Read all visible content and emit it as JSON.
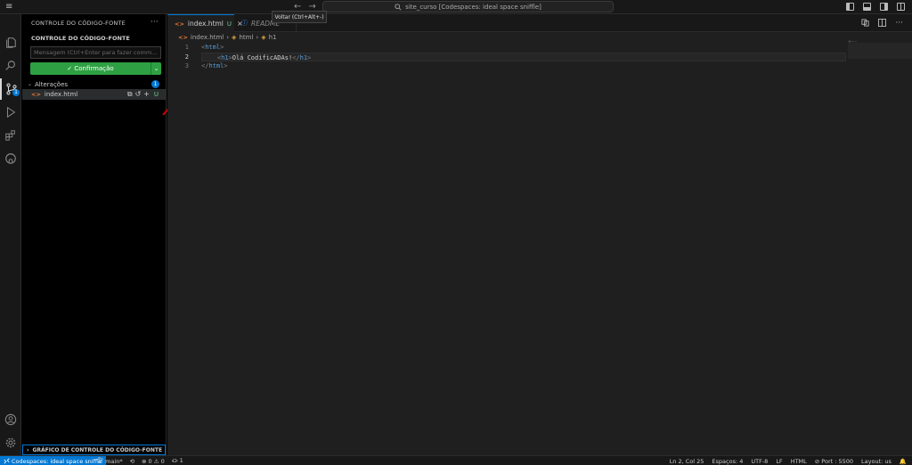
{
  "titlebar": {
    "command_center": "site_curso [Codespaces: ideal space sniffle]",
    "back_arrow": "←",
    "forward_arrow": "→",
    "menu_glyph": "≡"
  },
  "activity": {
    "scm_badge": "1"
  },
  "sidebar": {
    "title": "CONTROLE DO CÓDIGO-FONTE",
    "more_glyph": "···",
    "section_title": "CONTROLE DO CÓDIGO-FONTE",
    "message_placeholder": "Mensagem (Ctrl+Enter para fazer comm...",
    "commit_label": "✓ Confirmação",
    "commit_dropdown_glyph": "⌄",
    "changes_label": "Alterações",
    "changes_count": "1",
    "chevron": "⌄",
    "file": {
      "icon_glyph": "<>",
      "name": "index.html",
      "status": "U",
      "open_file_glyph": "⧉",
      "discard_glyph": "↺",
      "stage_glyph": "+"
    },
    "graph_title": "GRÁFICO DE CONTROLE DO CÓDIGO-FONTE",
    "graph_chevron": "›"
  },
  "editor": {
    "tabs": [
      {
        "label": "index.html",
        "status": "U",
        "close": "×",
        "icon": "<>"
      },
      {
        "label": "README",
        "icon": "ⓘ"
      }
    ],
    "tooltip": "Voltar (Ctrl+Alt+-)",
    "breadcrumb": {
      "file": "index.html",
      "sep": "›",
      "item1": "html",
      "item2": "h1",
      "file_icon": "<>",
      "sym_icon": "◈"
    },
    "line_numbers": [
      "1",
      "2",
      "3"
    ],
    "code": {
      "l1_open": "<",
      "l1_tag": "html",
      "l1_close": ">",
      "l2_indent": "    ",
      "l2_open": "<",
      "l2_tag": "h1",
      "l2_close": ">",
      "l2_text": "Olá CodificADAs!",
      "l2_end_open": "</",
      "l2_end_tag": "h1",
      "l2_end_close": ">",
      "l3_open": "</",
      "l3_tag": "html",
      "l3_close": ">"
    },
    "minimap_glyph": "≈-···"
  },
  "statusbar": {
    "remote": "Codespaces: ideal space sniffle",
    "branch": "main*",
    "sync": "⟲",
    "problems": "⊗ 0 ⚠ 0",
    "ports": "⛮ 1",
    "position": "Ln 2, Col 25",
    "spaces": "Espaços: 4",
    "encoding": "UTF-8",
    "eol": "LF",
    "language": "HTML",
    "port": "⊘ Port : 5500",
    "layout": "Layout: us",
    "bell": "🔔"
  },
  "colors": {
    "accent": "#0078d4",
    "commit": "#2ea043",
    "arrow": "#c0000a",
    "untracked": "#73c991"
  }
}
